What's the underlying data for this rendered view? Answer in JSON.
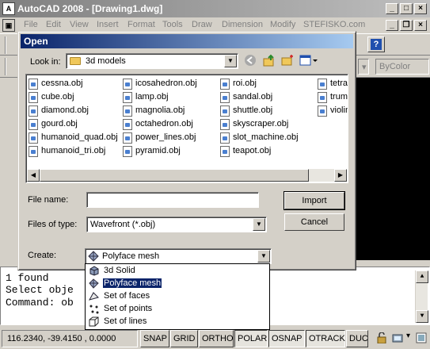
{
  "app": {
    "title": "AutoCAD 2008 - [Drawing1.dwg]",
    "menu": [
      "File",
      "Edit",
      "View",
      "Insert",
      "Format",
      "Tools",
      "Draw",
      "Dimension",
      "Modify",
      "STEFISKO.com"
    ],
    "layer_combo": "ByColor"
  },
  "command": {
    "lines": [
      "1 found",
      "Select obje",
      "Command: ob"
    ]
  },
  "status": {
    "coords": "116.2340, -39.4150 , 0.0000",
    "buttons": [
      "SNAP",
      "GRID",
      "ORTHO",
      "POLAR",
      "OSNAP",
      "OTRACK",
      "DUC"
    ],
    "active": [
      "POLAR",
      "OSNAP",
      "OTRACK"
    ]
  },
  "dialog": {
    "title": "Open",
    "look_in_label": "Look in:",
    "look_in_value": "3d models",
    "files": [
      [
        "cessna.obj",
        "cube.obj",
        "diamond.obj",
        "gourd.obj",
        "humanoid_quad.obj",
        "humanoid_tri.obj"
      ],
      [
        "icosahedron.obj",
        "lamp.obj",
        "magnolia.obj",
        "octahedron.obj",
        "power_lines.obj",
        "pyramid.obj"
      ],
      [
        "roi.obj",
        "sandal.obj",
        "shuttle.obj",
        "skyscraper.obj",
        "slot_machine.obj",
        "teapot.obj"
      ],
      [
        "tetral",
        "trump",
        "violin"
      ]
    ],
    "file_name_label": "File name:",
    "file_name_value": "",
    "file_type_label": "Files of type:",
    "file_type_value": "Wavefront (*.obj)",
    "create_label": "Create:",
    "create_value": "Polyface mesh",
    "import_label": "Import",
    "cancel_label": "Cancel",
    "create_options": [
      "3d Solid",
      "Polyface mesh",
      "Set of faces",
      "Set of points",
      "Set of lines"
    ],
    "create_selected": 1
  },
  "colors": {
    "dialog_title": "#0a246a",
    "selection": "#0a246a",
    "folder": "#f0c85a"
  }
}
